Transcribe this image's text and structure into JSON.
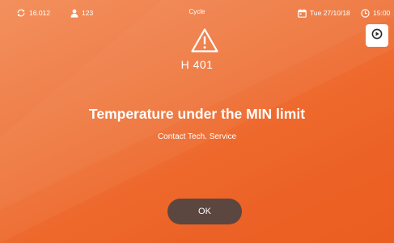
{
  "status_bar": {
    "cycle_count": "16.012",
    "user_count": "123",
    "mode_label": "Cycle",
    "date": "Tue 27/10/18",
    "time": "15:00"
  },
  "alarm": {
    "code": "H 401",
    "title": "Temperature under the MIN limit",
    "message": "Contact Tech. Service",
    "ok_label": "OK"
  },
  "icons": {
    "cycle": "refresh-icon",
    "user": "user-icon",
    "calendar": "calendar-icon",
    "clock": "clock-icon",
    "warning": "warning-triangle-icon",
    "play": "play-circle-icon"
  },
  "colors": {
    "background": "#ee6a2e",
    "ok_button": "#5b4640",
    "text": "#ffffff"
  }
}
